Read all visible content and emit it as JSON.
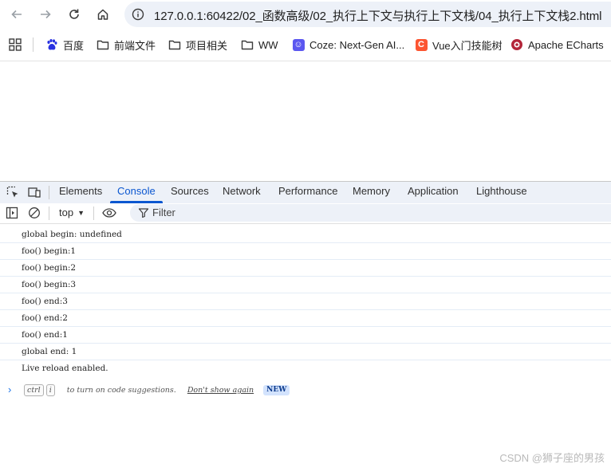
{
  "browser": {
    "url": "127.0.0.1:60422/02_函数高级/02_执行上下文与执行上下文栈/04_执行上下文栈2.html"
  },
  "bookmarks": [
    {
      "label": "百度",
      "icon": "baidu-paw-icon"
    },
    {
      "label": "前端文件",
      "icon": "folder-icon"
    },
    {
      "label": "项目相关",
      "icon": "folder-icon"
    },
    {
      "label": "WW",
      "icon": "folder-icon"
    },
    {
      "label": "Coze: Next-Gen AI...",
      "icon": "coze-icon",
      "color": "#5b57f0"
    },
    {
      "label": "Vue入门技能树",
      "icon": "csdn-c-icon",
      "color": "#fc5531"
    },
    {
      "label": "Apache ECharts",
      "icon": "echarts-icon",
      "color": "#b3263a"
    }
  ],
  "devtools": {
    "tabs": [
      "Elements",
      "Console",
      "Sources",
      "Network",
      "Performance",
      "Memory",
      "Application",
      "Lighthouse"
    ],
    "active_tab": "Console",
    "context": "top",
    "filter_placeholder": "Filter"
  },
  "console": {
    "lines": [
      "global begin: undefined",
      "foo() begin:1",
      "foo() begin:2",
      "foo() begin:3",
      "foo() end:3",
      "foo() end:2",
      "foo() end:1",
      "global end: 1",
      "Live reload enabled."
    ],
    "hint": {
      "key1": "ctrl",
      "key2": "i",
      "text": "to turn on code suggestions.",
      "dismiss": "Don't show again",
      "badge": "NEW"
    }
  },
  "watermark": "CSDN @狮子座的男孩",
  "colors": {
    "accent": "#0b57d0",
    "toolbar_bg": "#edf1f8"
  }
}
